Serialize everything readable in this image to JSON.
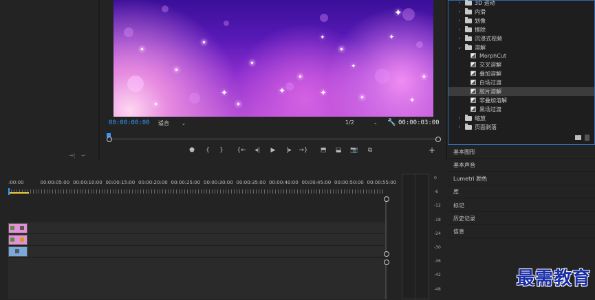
{
  "program": {
    "timecode_current": "00:00:00:00",
    "fit_label": "适合",
    "resolution": "1/2",
    "timecode_duration": "00:00:03:00"
  },
  "effects": {
    "items": [
      {
        "label": "3D 运动",
        "kind": "folder",
        "expanded": false
      },
      {
        "label": "内滑",
        "kind": "folder",
        "expanded": false
      },
      {
        "label": "划像",
        "kind": "folder",
        "expanded": false
      },
      {
        "label": "擦除",
        "kind": "folder",
        "expanded": false
      },
      {
        "label": "沉浸式视频",
        "kind": "folder",
        "expanded": false
      },
      {
        "label": "溶解",
        "kind": "folder",
        "expanded": true
      },
      {
        "label": "MorphCut",
        "kind": "effect"
      },
      {
        "label": "交叉溶解",
        "kind": "effect"
      },
      {
        "label": "叠加溶解",
        "kind": "effect"
      },
      {
        "label": "白场过渡",
        "kind": "effect"
      },
      {
        "label": "胶片溶解",
        "kind": "effect",
        "selected": true
      },
      {
        "label": "非叠加溶解",
        "kind": "effect"
      },
      {
        "label": "黑场过渡",
        "kind": "effect"
      },
      {
        "label": "缩放",
        "kind": "folder",
        "expanded": false
      },
      {
        "label": "页面剥落",
        "kind": "folder",
        "expanded": false
      }
    ]
  },
  "side_panels": [
    "基本图形",
    "基本声音",
    "Lumetri 颜色",
    "库",
    "标记",
    "历史记录",
    "信息"
  ],
  "timeline": {
    "ruler_labels": [
      ":00:00",
      "00:00:05:00",
      "00:00:10:00",
      "00:00:15:00",
      "00:00:20:00",
      "00:00:25:00",
      "00:00:30:00",
      "00:00:35:00",
      "00:00:40:00",
      "00:00:45:00",
      "00:00:50:00",
      "00:00:55:00"
    ]
  },
  "meter": {
    "labels": [
      "0",
      "-6",
      "-12",
      "-18",
      "-24",
      "-30",
      "-36",
      "-42",
      "-48"
    ]
  },
  "watermark": "最需教育",
  "colors": {
    "accent_blue": "#2f9bff",
    "clip_pink": "#e58fd7",
    "clip_blue": "#7ba9d9",
    "panel_border_selected": "#2d6bb3"
  }
}
